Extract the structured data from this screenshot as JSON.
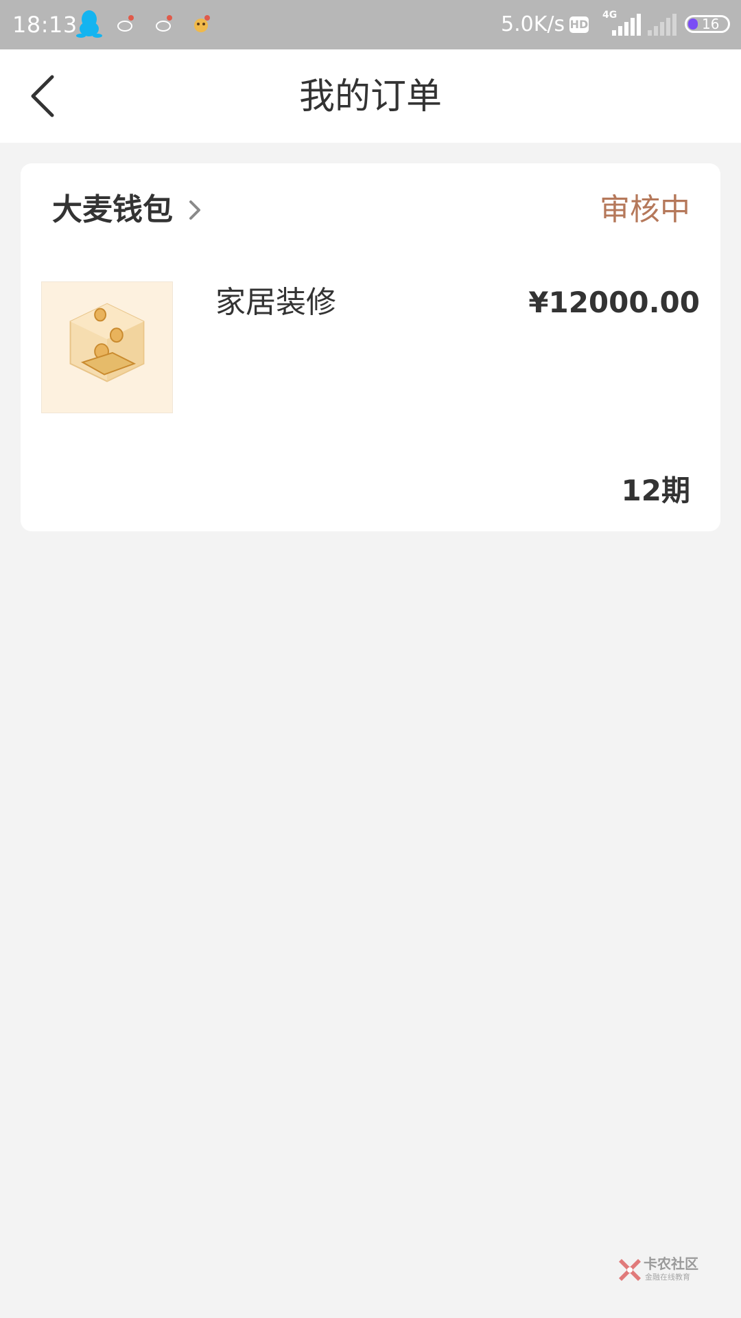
{
  "status_bar": {
    "time": "18:13",
    "network_speed": "5.0K/s",
    "hd_label": "HD",
    "network_type": "4G",
    "battery_level": "16",
    "icons": [
      "qq-icon",
      "notification-icon",
      "notification-icon",
      "notification-icon",
      "hd-icon",
      "signal-icon",
      "signal-icon",
      "battery-icon"
    ]
  },
  "header": {
    "title": "我的订单",
    "back_icon": "chevron-left-icon"
  },
  "order": {
    "merchant": "大麦钱包",
    "status": "审核中",
    "product_name": "家居装修",
    "price": "¥12000.00",
    "installments": "12期",
    "colors": {
      "status": "#b5785a",
      "text": "#333333"
    }
  },
  "watermark": {
    "title": "卡农社区",
    "subtitle": "金融在线教育"
  }
}
